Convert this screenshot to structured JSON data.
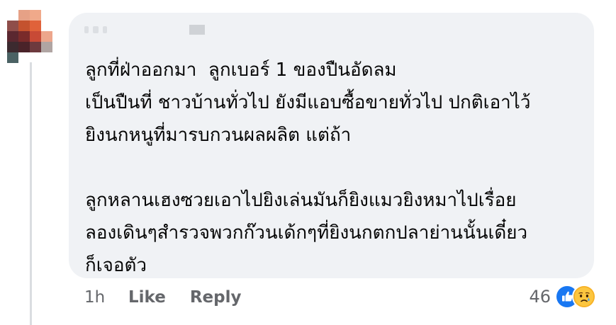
{
  "comment": {
    "lines": [
      "ลูกที่ฝ่าออกมา  ลูกเบอร์ 1 ของปืนอัดลม",
      "เป็นปืนที่ ชาวบ้านทั่วไป ยังมีแอบซื้อขายทั่วไป ปกติเอาไว้",
      "ยิงนกหนูที่มารบกวนผลผลิต แต่ถ้า",
      "ลูกหลานเฮงซวยเอาไปยิงเล่นมันก็ยิงแมวยิงหมาไปเรื่อย",
      "ลองเดินๆสำรวจพวกก๊วนเด้กๆที่ยิงนกตกปลาย่านนั้นเดี๋ยว",
      "ก็เจอตัว"
    ]
  },
  "actions": {
    "time": "1h",
    "like_label": "Like",
    "reply_label": "Reply"
  },
  "reactions": {
    "count": "46",
    "icons": [
      "like-icon",
      "sad-icon"
    ]
  },
  "colors": {
    "bubble": "#f0f2f5",
    "text": "#050505",
    "secondary_text": "#65676b",
    "like_blue": "#1877f2",
    "sad_yellow": "#f7b125",
    "thread_line": "#dadde1"
  }
}
